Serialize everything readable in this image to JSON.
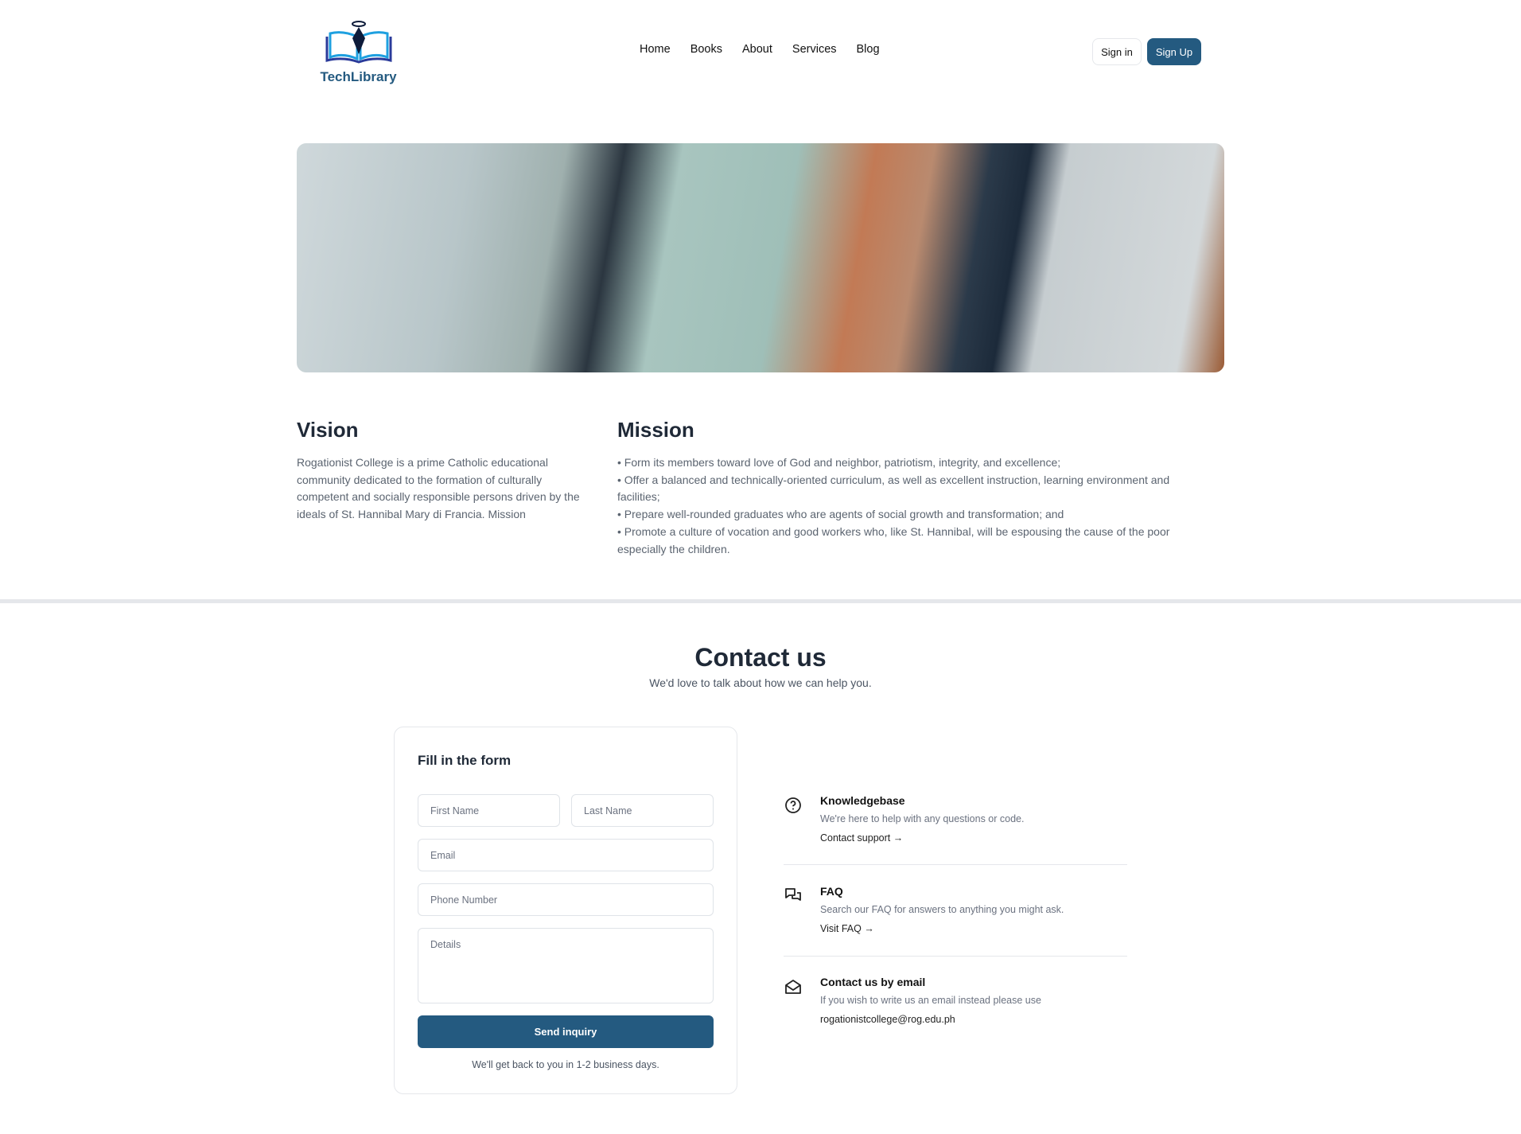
{
  "brand": {
    "name": "TechLibrary"
  },
  "nav": {
    "items": [
      "Home",
      "Books",
      "About",
      "Services",
      "Blog"
    ],
    "sign_in": "Sign in",
    "sign_up": "Sign Up"
  },
  "vision": {
    "title": "Vision",
    "text": "Rogationist College is a prime Catholic educational community dedicated to the formation of culturally competent and socially responsible persons driven by the ideals of St. Hannibal Mary di Francia. Mission"
  },
  "mission": {
    "title": "Mission",
    "items": [
      "• Form its members toward love of God and neighbor, patriotism, integrity, and excellence;",
      "• Offer a balanced and technically-oriented curriculum, as well as excellent instruction, learning environment and facilities;",
      "• Prepare well-rounded graduates who are agents of social growth and transformation; and",
      "• Promote a culture of vocation and good workers who, like St. Hannibal, will be espousing the cause of the poor especially the children."
    ]
  },
  "contact": {
    "title": "Contact us",
    "subtitle": "We'd love to talk about how we can help you.",
    "form": {
      "title": "Fill in the form",
      "first_name": "First Name",
      "last_name": "Last Name",
      "email": "Email",
      "phone": "Phone Number",
      "details": "Details",
      "submit": "Send inquiry",
      "note": "We'll get back to you in 1-2 business days."
    },
    "info": [
      {
        "icon": "question-circle-icon",
        "title": "Knowledgebase",
        "desc": "We're here to help with any questions or code.",
        "link": "Contact support →"
      },
      {
        "icon": "chat-bubbles-icon",
        "title": "FAQ",
        "desc": "Search our FAQ for answers to anything you might ask.",
        "link": "Visit FAQ →"
      },
      {
        "icon": "envelope-open-icon",
        "title": "Contact us by email",
        "desc": "If you wish to write us an email instead please use",
        "link": "rogationistcollege@rog.edu.ph"
      }
    ]
  },
  "colors": {
    "primary": "#245a80"
  }
}
